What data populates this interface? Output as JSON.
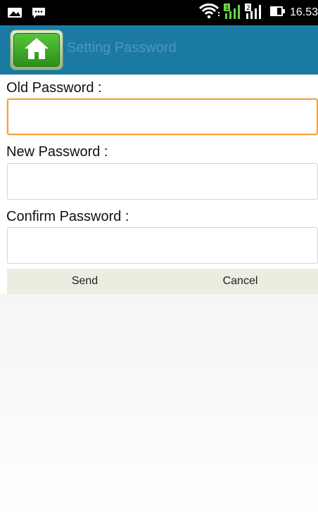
{
  "status_bar": {
    "left_icons": [
      "image-notification-icon",
      "chat-notification-icon"
    ],
    "right_icons": [
      "wifi-icon",
      "signal-sim1-icon",
      "signal-sim2-icon",
      "battery-icon"
    ],
    "time": "16.53"
  },
  "header": {
    "home_icon": "home-icon",
    "title": "Setting Password"
  },
  "form": {
    "old_password": {
      "label": "Old Password :",
      "value": ""
    },
    "new_password": {
      "label": "New Password :",
      "value": ""
    },
    "confirm_password": {
      "label": "Confirm Password :",
      "value": ""
    }
  },
  "actions": {
    "send_label": "Send",
    "cancel_label": "Cancel"
  },
  "colors": {
    "header_bg": "#1b7aa3",
    "title_text": "#4d97bd",
    "focus_border": "#f0a13c",
    "button_bar_bg": "#ecece1"
  }
}
